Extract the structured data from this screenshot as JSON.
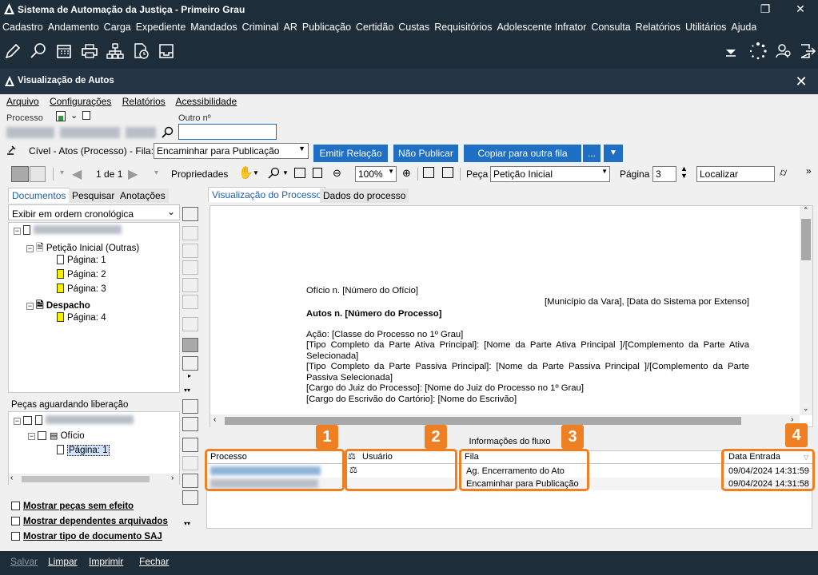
{
  "window": {
    "title": "Sistema de Automação da Justiça - Primeiro Grau"
  },
  "menubar": [
    "Cadastro",
    "Andamento",
    "Carga",
    "Expediente",
    "Mandados",
    "Criminal",
    "AR",
    "Publicação",
    "Certidão",
    "Custas",
    "Requisitórios",
    "Adolescente Infrator",
    "Consulta",
    "Relatórios",
    "Utilitários",
    "Ajuda"
  ],
  "subwindow": {
    "title": "Visualização de Autos"
  },
  "menu2": [
    "Arquivo",
    "Configurações",
    "Relatórios",
    "Acessibilidade"
  ],
  "process": {
    "label": "Processo",
    "outro_label": "Outro nº",
    "outro_value": ""
  },
  "fila": {
    "label": "Cível - Atos (Processo) - Fila:",
    "value": "Encaminhar para Publicação"
  },
  "buttons": {
    "emitir": "Emitir Relação",
    "nao_publicar": "Não Publicar",
    "copiar": "Copiar para outra fila",
    "more": "..."
  },
  "viewer_toolbar": {
    "page_of": "1 de 1",
    "propriedades": "Propriedades",
    "zoom": "100%",
    "peca_label": "Peça",
    "peca_value": "Petição Inicial",
    "pagina_label": "Página",
    "pagina_value": "3",
    "localizar": "Localizar"
  },
  "left_tabs": [
    "Documentos",
    "Pesquisar",
    "Anotações"
  ],
  "order_select": "Exibir em ordem cronológica",
  "tree": {
    "peticao": "Petição Inicial (Outras)",
    "pages": [
      "Página: 1",
      "Página: 2",
      "Página: 3"
    ],
    "despacho": "Despacho",
    "despacho_page": "Página: 4"
  },
  "pecas": {
    "title": "Peças aguardando liberação",
    "oficio": "Ofício",
    "pagina": "Página: 1"
  },
  "checks": [
    "Mostrar peças sem efeito",
    "Mostrar dependentes arquivados",
    "Mostrar tipo de documento SAJ"
  ],
  "viewer_tabs": [
    "Visualização do Processo",
    "Dados do processo"
  ],
  "doc": {
    "l1": "Ofício n. [Número do Ofício]",
    "l2": "[Município da Vara], [Data do Sistema por Extenso]",
    "l3": "Autos n. [Número do Processo]",
    "l4": "Ação: [Classe do Processo no 1º Grau]",
    "l5": "[Tipo Completo da Parte Ativa Principal]: [Nome da Parte Ativa Principal ]/[Complemento da Parte Ativa Selecionada]",
    "l6": "[Tipo Completo da Parte Passiva Principal]: [Nome da Parte Passiva Principal ]/[Complemento da Parte Passiva Selecionada]",
    "l7": "[Cargo do Juiz do Processo]: [Nome do Juiz do Processo no 1º Grau]",
    "l8": "[Cargo do Escrivão do Cartório]: [Nome do Escrivão]"
  },
  "flow": {
    "title": "Informações do fluxo",
    "headers": {
      "processo": "Processo",
      "usuario": "Usuário",
      "fila": "Fila",
      "data": "Data Entrada"
    },
    "rows": [
      {
        "fila": "Ag. Encerramento do Ato",
        "data": "09/04/2024 14:31:59"
      },
      {
        "fila": "Encaminhar para Publicação",
        "data": "09/04/2024 14:31:58"
      }
    ]
  },
  "badges": [
    "1",
    "2",
    "3",
    "4"
  ],
  "bottom": [
    "Salvar",
    "Limpar",
    "Imprimir",
    "Fechar"
  ],
  "colors": {
    "dark": "#1e2d3a",
    "blue": "#1f6fc5",
    "orange": "#ee7f22"
  }
}
